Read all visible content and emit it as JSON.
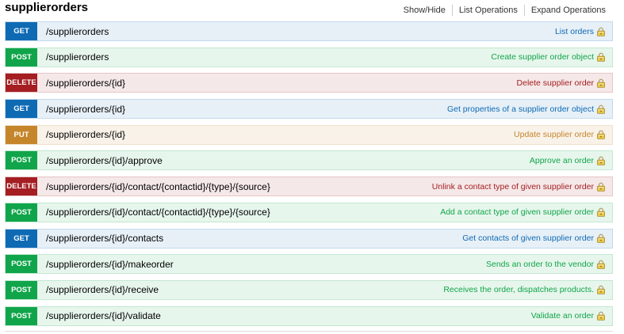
{
  "section": {
    "title": "supplierorders",
    "links": [
      "Show/Hide",
      "List Operations",
      "Expand Operations"
    ]
  },
  "colors": {
    "get": "#0f6ab4",
    "post": "#10a54a",
    "delete": "#a41e22",
    "put": "#c5862b"
  },
  "operations": [
    {
      "method": "GET",
      "path": "/supplierorders",
      "summary": "List orders",
      "icon": "lock-icon"
    },
    {
      "method": "POST",
      "path": "/supplierorders",
      "summary": "Create supplier order object",
      "icon": "lock-icon"
    },
    {
      "method": "DELETE",
      "path": "/supplierorders/{id}",
      "summary": "Delete supplier order",
      "icon": "lock-icon"
    },
    {
      "method": "GET",
      "path": "/supplierorders/{id}",
      "summary": "Get properties of a supplier order object",
      "icon": "lock-icon"
    },
    {
      "method": "PUT",
      "path": "/supplierorders/{id}",
      "summary": "Update supplier order",
      "icon": "lock-icon"
    },
    {
      "method": "POST",
      "path": "/supplierorders/{id}/approve",
      "summary": "Approve an order",
      "icon": "lock-icon"
    },
    {
      "method": "DELETE",
      "path": "/supplierorders/{id}/contact/{contactid}/{type}/{source}",
      "summary": "Unlink a contact type of given supplier order",
      "icon": "lock-icon"
    },
    {
      "method": "POST",
      "path": "/supplierorders/{id}/contact/{contactid}/{type}/{source}",
      "summary": "Add a contact type of given supplier order",
      "icon": "lock-icon"
    },
    {
      "method": "GET",
      "path": "/supplierorders/{id}/contacts",
      "summary": "Get contacts of given supplier order",
      "icon": "lock-icon"
    },
    {
      "method": "POST",
      "path": "/supplierorders/{id}/makeorder",
      "summary": "Sends an order to the vendor",
      "icon": "lock-icon"
    },
    {
      "method": "POST",
      "path": "/supplierorders/{id}/receive",
      "summary": "Receives the order, dispatches products.",
      "icon": "lock-icon"
    },
    {
      "method": "POST",
      "path": "/supplierorders/{id}/validate",
      "summary": "Validate an order",
      "icon": "lock-icon"
    }
  ]
}
